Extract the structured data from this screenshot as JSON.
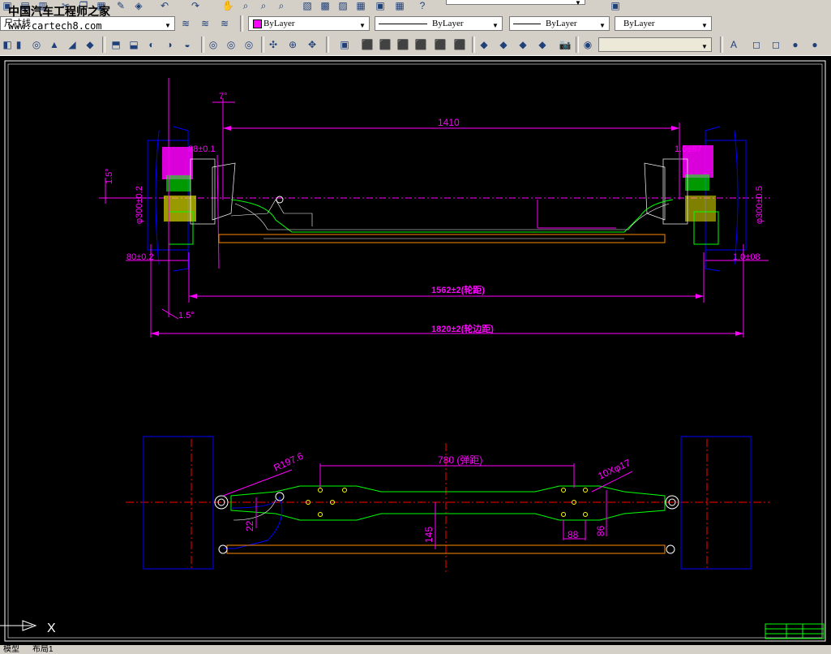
{
  "watermark": {
    "site_name": "中国汽车工程师之家",
    "url": "www.cartech8.com"
  },
  "toolbar": {
    "dim_style_label": "尺寸线",
    "color_combo": {
      "value": "ByLayer",
      "swatch_color": "#ff00ff"
    },
    "linetype_combo": {
      "value": "ByLayer"
    },
    "lineweight_combo": {
      "value": "ByLayer"
    },
    "plotstyle_combo": {
      "value": "ByLayer"
    }
  },
  "top_view": {
    "dim_overall_1410": "1410",
    "dim_angle_7": "7°",
    "dim_angle_1_5_left": "1.5°",
    "dim_angle_1_5_bottom": "1.5°",
    "dim_left_28": "28±0.1",
    "dim_right_28": "1.0±87",
    "dim_left_dia": "φ300±0.2",
    "dim_right_dia": "φ300±0.5",
    "dim_left_80": "80±0.2",
    "dim_right_80": "1.0±08",
    "dim_track": "1562±2(轮距)",
    "dim_tire_track": "1820±2(轮边距)"
  },
  "bottom_view": {
    "dim_radius": "R197.6",
    "dim_spring_780": "780 (弹距)",
    "dim_holes": "10Xφ17",
    "dim_22": "22",
    "dim_145": "145",
    "dim_88": "88",
    "dim_86": "86"
  },
  "ucs": {
    "x_label": "X"
  },
  "layout_tabs": [
    "模型",
    "布局1"
  ],
  "colors": {
    "dimension": "#ff00ff",
    "outline": "#0000ff",
    "part": "#00ff00",
    "center": "#ff0000",
    "tie_rod": "#ff8c00",
    "background": "#000000"
  }
}
